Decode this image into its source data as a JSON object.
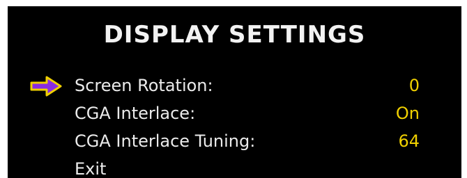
{
  "title": "DISPLAY SETTINGS",
  "colors": {
    "background": "#000000",
    "label_text": "#ebebeb",
    "value_text": "#f0d000",
    "cursor_fill": "#8a2be2",
    "cursor_outline": "#f0d000"
  },
  "menu": {
    "selected_index": 0,
    "cursor_icon": "arrow-right-icon",
    "items": [
      {
        "label": "Screen Rotation:",
        "value": "0"
      },
      {
        "label": "CGA Interlace:",
        "value": "On"
      },
      {
        "label": "CGA Interlace Tuning:",
        "value": "64"
      },
      {
        "label": "Exit",
        "value": ""
      }
    ]
  }
}
